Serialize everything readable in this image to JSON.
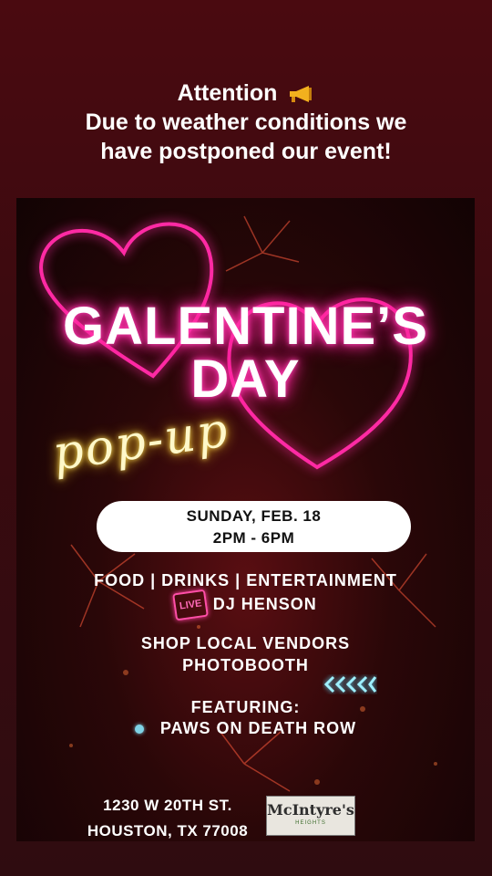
{
  "header": {
    "line1": "Attention",
    "line2": "Due to weather conditions we",
    "line3": "have postponed our event!"
  },
  "flyer": {
    "title_line1": "GALENTINE’S",
    "title_line2": "DAY",
    "script_text": "pop-up",
    "date": "SUNDAY, FEB. 18",
    "time": "2PM - 6PM",
    "features": "FOOD | DRINKS | ENTERTAINMENT",
    "live_badge": "LIVE",
    "dj": "DJ HENSON",
    "vendors": "SHOP LOCAL VENDORS",
    "photobooth": "PHOTOBOOTH",
    "featuring_label": "FEATURING:",
    "featuring_name": "PAWS ON DEATH ROW",
    "address_line1": "1230 W 20TH ST.",
    "address_line2": "HOUSTON, TX 77008",
    "logo_name": "McIntyre's",
    "logo_sub": "HEIGHTS"
  },
  "colors": {
    "neon_pink": "#ff2aa4",
    "neon_yellow": "#ffe35a",
    "accent_cyan": "#7fd3e6",
    "background": "#3a0a0f"
  },
  "icons": {
    "header": "megaphone-icon",
    "featuring": "dot-icon",
    "decor": "chevrons-left-icon"
  }
}
